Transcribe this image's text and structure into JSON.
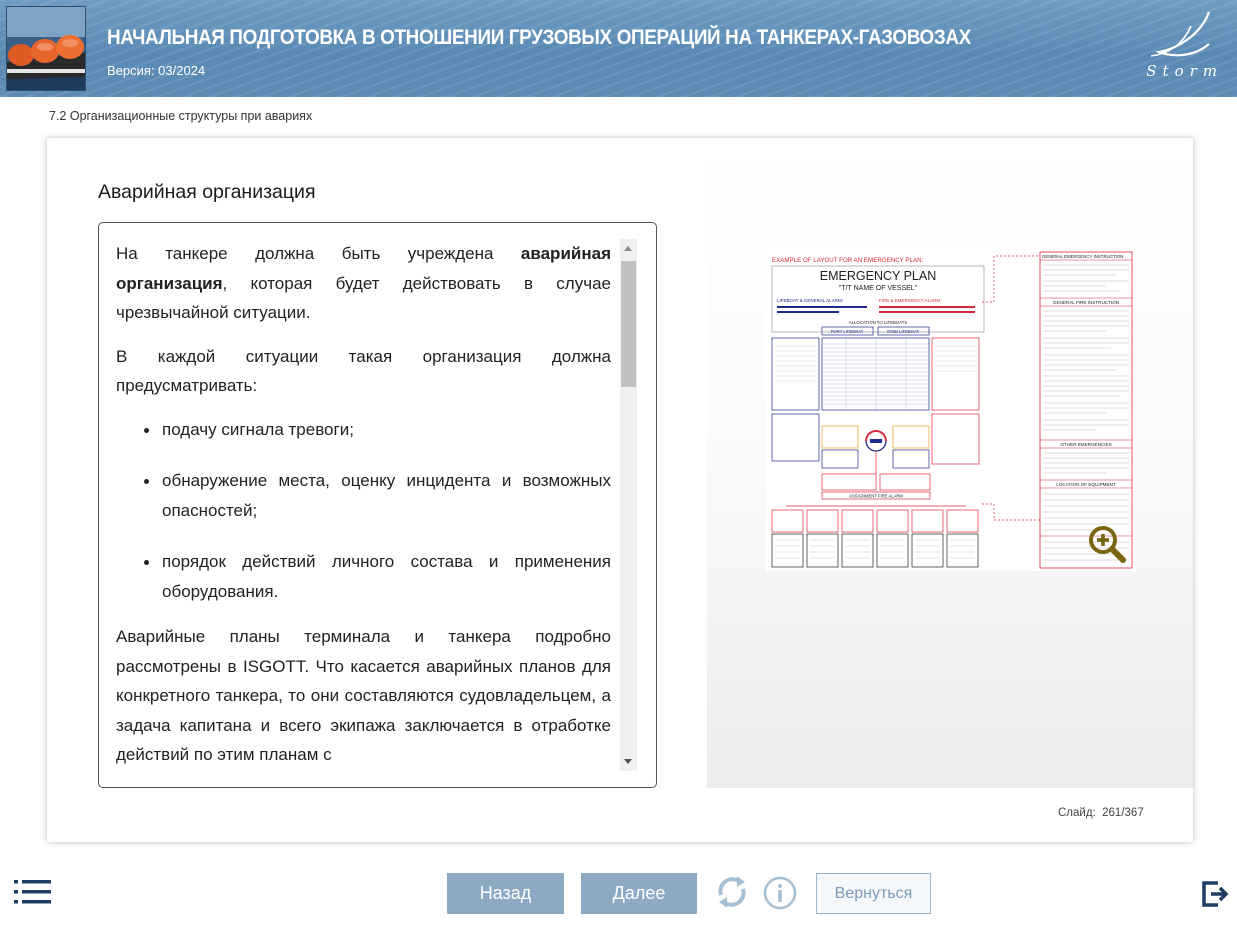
{
  "header": {
    "course_title": "НАЧАЛЬНАЯ ПОДГОТОВКА В ОТНОШЕНИИ ГРУЗОВЫХ ОПЕРАЦИЙ НА ТАНКЕРАХ-ГАЗОВОЗАХ",
    "version": "Версия: 03/2024",
    "logo_text": "Storm"
  },
  "breadcrumb": "7.2 Организационные структуры при авариях",
  "content": {
    "section_title": "Аварийная организация",
    "p1_before": "На танкере должна быть учреждена ",
    "p1_bold": "аварийная организация",
    "p1_after": ", которая будет действовать в случае чрезвычайной ситуации.",
    "p2": "В каждой ситуации такая организация должна предусматривать:",
    "bullets": [
      "подачу сигнала тревоги;",
      "обнаружение места, оценку инцидента и возможных опасностей;",
      "порядок действий личного состава и применения оборудования."
    ],
    "p3": "Аварийные планы терминала и танкера подробно рассмотрены в ISGOTT. Что касается аварийных планов для конкретного танкера, то они составляются судовладельцем, а задача капитана и всего экипажа заключается в отработке действий по этим планам с"
  },
  "plan": {
    "example_label": "EXAMPLE OF LAYOUT FOR AN EMERGENCY PLAN:",
    "title": "EMERGENCY PLAN",
    "vessel": "\"T/T NAME OF VESSEL\"",
    "lifeboat_alarm": "LIFEBOAT & GENERAL ALARM:",
    "fire_alarm": "FIRE & EMERGENCY ALARM:",
    "allocation": "ALLOCATION TO LIFEBOATS",
    "port_lifeboat": "PORT LIFEBOAT",
    "stbd_lifeboat": "STBD LIFEBOAT",
    "assignment": "ASSIGNMENT FIRE ALARM",
    "general_emergency": "GENERAL EMERGENCY INSTRUCTION",
    "general_fire": "GENERAL FIRE INSTRUCTION",
    "other_emergencies": "OTHER EMERGENCIES",
    "location_equipment": "LOCATION OF EQUIPMENT"
  },
  "slide_counter": {
    "label": "Слайд:",
    "current": "261",
    "separator": "/",
    "total": "367"
  },
  "nav": {
    "back_label": "Назад",
    "next_label": "Далее",
    "return_label": "Вернуться"
  },
  "icons": {
    "menu": "list-menu-icon",
    "refresh": "refresh-icon",
    "info": "info-icon",
    "exit": "exit-icon",
    "zoom": "zoom-in-icon"
  },
  "colors": {
    "header_blue": "#5e8cb5",
    "button_blue": "#8ea9c3",
    "icon_navy": "#1d3d62",
    "plan_red": "#d9283a",
    "plan_navy": "#20288a"
  }
}
